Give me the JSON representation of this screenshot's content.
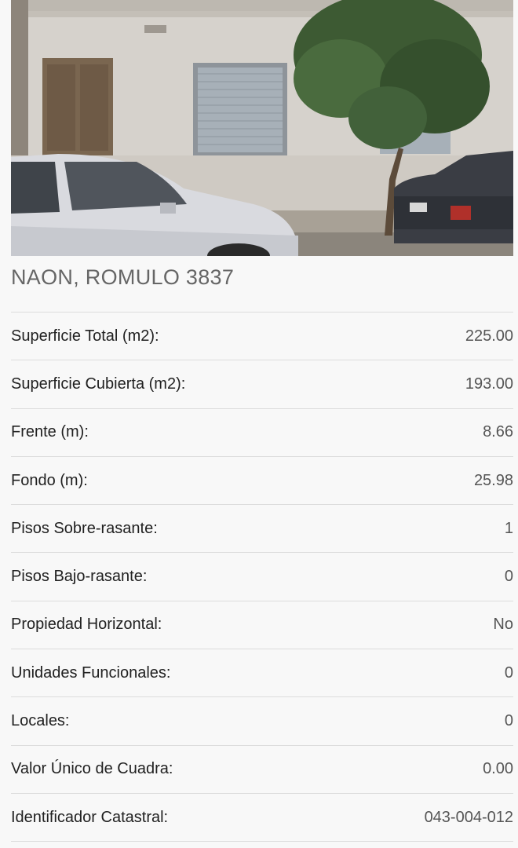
{
  "property": {
    "address": "NAON, ROMULO 3837",
    "photo_alt": "Fachada del inmueble",
    "details": [
      {
        "label": "Superficie Total (m2):",
        "value": "225.00"
      },
      {
        "label": "Superficie Cubierta (m2):",
        "value": "193.00"
      },
      {
        "label": "Frente (m):",
        "value": "8.66"
      },
      {
        "label": "Fondo (m):",
        "value": "25.98"
      },
      {
        "label": "Pisos Sobre-rasante:",
        "value": "1"
      },
      {
        "label": "Pisos Bajo-rasante:",
        "value": "0"
      },
      {
        "label": "Propiedad Horizontal:",
        "value": "No"
      },
      {
        "label": "Unidades Funcionales:",
        "value": "0"
      },
      {
        "label": "Locales:",
        "value": "0"
      },
      {
        "label": "Valor Único de Cuadra:",
        "value": "0.00"
      },
      {
        "label": "Identificador Catastral:",
        "value": "043-004-012"
      }
    ]
  },
  "colors": {
    "background": "#f8f8f8",
    "divider": "#dcdcdc",
    "address_text": "#666666",
    "label_text": "#212121",
    "value_text": "#555555"
  }
}
